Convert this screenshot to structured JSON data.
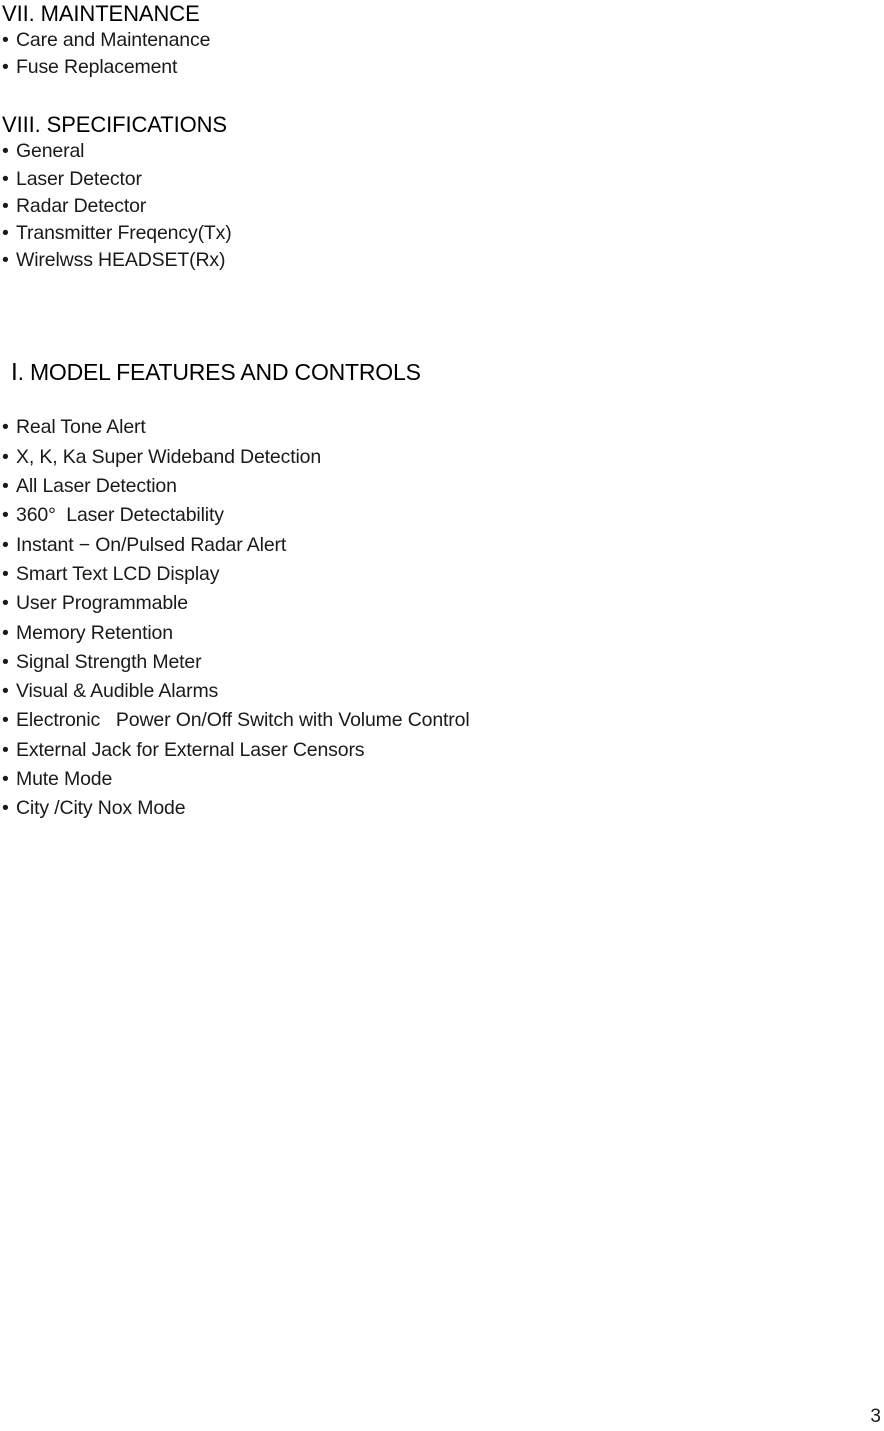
{
  "document": {
    "page_number": "3",
    "bullet_glyph": "•"
  },
  "toc_sections": [
    {
      "heading": "VII. MAINTENANCE",
      "items": [
        "Care and Maintenance",
        "Fuse Replacement"
      ]
    },
    {
      "heading": "VIII. SPECIFICATIONS",
      "items": [
        "General",
        "Laser Detector",
        "Radar Detector",
        "Transmitter Freqency(Tx)",
        "Wirelwss HEADSET(Rx)"
      ]
    }
  ],
  "main_section": {
    "heading": "Ⅰ. MODEL FEATURES AND CONTROLS",
    "features": [
      "Real Tone Alert",
      "X, K, Ka Super Wideband Detection",
      "All Laser Detection",
      "360°  Laser Detectability",
      "Instant − On/Pulsed Radar Alert",
      "Smart Text LCD Display",
      "User Programmable",
      "Memory Retention",
      "Signal Strength Meter",
      "Visual & Audible Alarms",
      "Electronic   Power On/Off Switch with Volume Control",
      "External Jack for External Laser Censors",
      "Mute Mode",
      "City /City Nox Mode"
    ]
  }
}
